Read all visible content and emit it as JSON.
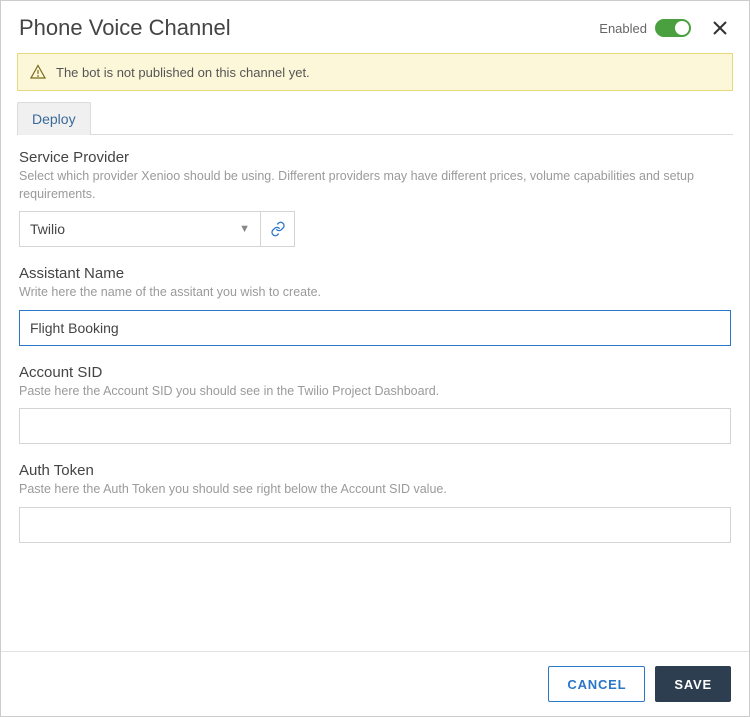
{
  "header": {
    "title": "Phone Voice Channel",
    "enabled_label": "Enabled"
  },
  "banner": {
    "message": "The bot is not published on this channel yet."
  },
  "tabs": [
    {
      "label": "Deploy"
    }
  ],
  "fields": {
    "service_provider": {
      "label": "Service Provider",
      "desc": "Select which provider Xenioo should be using. Different providers may have different prices, volume capabilities and setup requirements.",
      "selected": "Twilio"
    },
    "assistant_name": {
      "label": "Assistant Name",
      "desc": "Write here the name of the assitant you wish to create.",
      "value": "Flight Booking"
    },
    "account_sid": {
      "label": "Account SID",
      "desc": "Paste here the Account SID you should see in the Twilio Project Dashboard.",
      "value": ""
    },
    "auth_token": {
      "label": "Auth Token",
      "desc": "Paste here the Auth Token you should see right below the Account SID value.",
      "value": ""
    }
  },
  "footer": {
    "cancel": "CANCEL",
    "save": "SAVE"
  }
}
